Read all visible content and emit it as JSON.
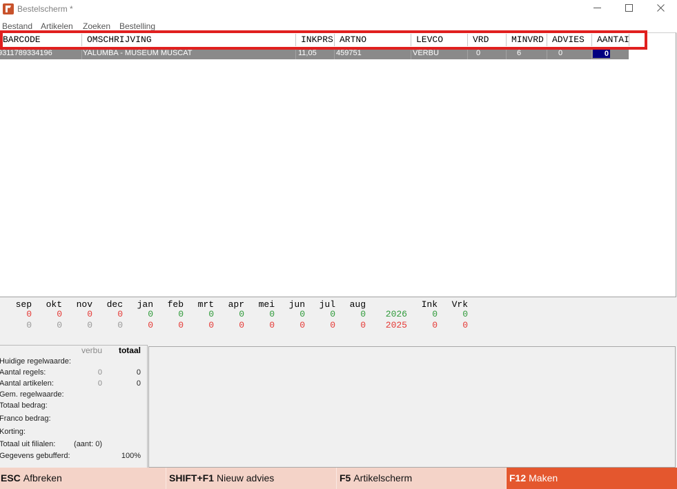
{
  "window": {
    "title": "Bestelscherm *",
    "icons": {
      "app": "app-logo-icon",
      "minimize": "minimize-icon",
      "maximize": "maximize-icon",
      "close": "close-icon"
    }
  },
  "menu": {
    "items": [
      {
        "label": "Bestand"
      },
      {
        "label": "Artikelen"
      },
      {
        "label": "Zoeken"
      },
      {
        "label": "Bestelling"
      }
    ]
  },
  "table": {
    "columns": [
      "BARCODE",
      "OMSCHRIJVING",
      "INKPRS",
      "ARTNO",
      "LEVCO",
      "VRD",
      "MINVRD",
      "ADVIES",
      "AANTAI"
    ],
    "rows": [
      {
        "barcode": "9311789334196",
        "omschrijving": "YALUMBA - MUSEUM MUSCAT",
        "inkprs": "11,05",
        "artno": "459751",
        "levco": "VERBU",
        "vrd": "0",
        "minvrd": "6",
        "advies": "0",
        "aantal": "0"
      }
    ]
  },
  "stats": {
    "months": [
      "sep",
      "okt",
      "nov",
      "dec",
      "jan",
      "feb",
      "mrt",
      "apr",
      "mei",
      "jun",
      "jul",
      "aug"
    ],
    "ink_label": "Ink",
    "vrk_label": "Vrk",
    "rows": [
      {
        "year": {
          "v": "2026",
          "c": "green"
        },
        "months": [
          {
            "v": "0",
            "c": "red"
          },
          {
            "v": "0",
            "c": "red"
          },
          {
            "v": "0",
            "c": "red"
          },
          {
            "v": "0",
            "c": "red"
          },
          {
            "v": "0",
            "c": "green"
          },
          {
            "v": "0",
            "c": "green"
          },
          {
            "v": "0",
            "c": "green"
          },
          {
            "v": "0",
            "c": "green"
          },
          {
            "v": "0",
            "c": "green"
          },
          {
            "v": "0",
            "c": "green"
          },
          {
            "v": "0",
            "c": "green"
          },
          {
            "v": "0",
            "c": "green"
          }
        ],
        "ink": {
          "v": "0",
          "c": "green"
        },
        "vrk": {
          "v": "0",
          "c": "green"
        }
      },
      {
        "year": {
          "v": "2025",
          "c": "red"
        },
        "months": [
          {
            "v": "0",
            "c": "gray"
          },
          {
            "v": "0",
            "c": "gray"
          },
          {
            "v": "0",
            "c": "gray"
          },
          {
            "v": "0",
            "c": "gray"
          },
          {
            "v": "0",
            "c": "red"
          },
          {
            "v": "0",
            "c": "red"
          },
          {
            "v": "0",
            "c": "red"
          },
          {
            "v": "0",
            "c": "red"
          },
          {
            "v": "0",
            "c": "red"
          },
          {
            "v": "0",
            "c": "red"
          },
          {
            "v": "0",
            "c": "red"
          },
          {
            "v": "0",
            "c": "red"
          }
        ],
        "ink": {
          "v": "0",
          "c": "red"
        },
        "vrk": {
          "v": "0",
          "c": "red"
        }
      }
    ]
  },
  "summary": {
    "col_verbu": "verbu",
    "col_totaal": "totaal",
    "lines": [
      {
        "label": "Huidige regelwaarde:"
      },
      {
        "label": "Aantal regels:",
        "verbu": "0",
        "totaal": "0"
      },
      {
        "label": "Aantal artikelen:",
        "verbu": "0",
        "totaal": "0"
      },
      {
        "label": "Gem. regelwaarde:"
      },
      {
        "label": "Totaal bedrag:"
      },
      {
        "label": "Franco bedrag:"
      },
      {
        "label": "Korting:"
      },
      {
        "label": "Totaal uit filialen:",
        "verbu": "(aant: 0)"
      },
      {
        "label": "Gegevens gebufferd:",
        "totaal": "100%"
      }
    ]
  },
  "function_keys": [
    {
      "key": "ESC",
      "label": "Afbreken"
    },
    {
      "key": "SHIFT+F1",
      "label": "Nieuw advies"
    },
    {
      "key": "F5",
      "label": "Artikelscherm"
    },
    {
      "key": "F12",
      "label": "Maken"
    }
  ],
  "colors": {
    "red": "#e53935",
    "green": "#2f9a3a",
    "gray": "#9a9a9a",
    "selection_row": "#8a8a8a",
    "input_cell": "#000080",
    "key_button": "#f4d3c8",
    "key_button_primary": "#e4572e",
    "highlight_box": "#e0201f"
  }
}
